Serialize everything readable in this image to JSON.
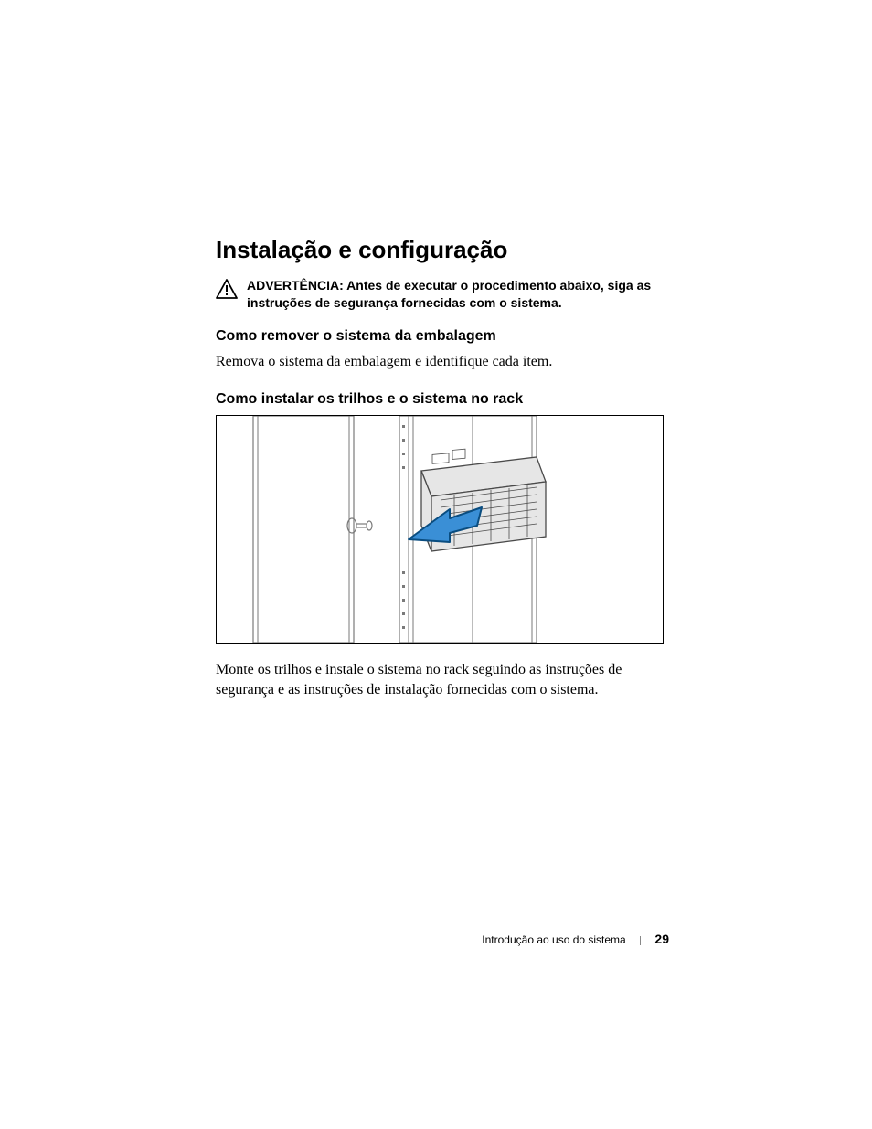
{
  "section_title": "Instalação e configuração",
  "warning": {
    "label": "ADVERTÊNCIA:",
    "text": "Antes de executar o procedimento abaixo, siga as instruções de segurança fornecidas com o sistema."
  },
  "unpack": {
    "heading": "Como remover o sistema da embalagem",
    "body": "Remova o sistema da embalagem e identifique cada item."
  },
  "rack": {
    "heading": "Como instalar os trilhos e o sistema no rack",
    "body": "Monte os trilhos e instale o sistema no rack seguindo as instruções de segurança e as instruções de instalação fornecidas com o sistema."
  },
  "footer": {
    "chapter": "Introdução ao uso do sistema",
    "page": "29"
  }
}
